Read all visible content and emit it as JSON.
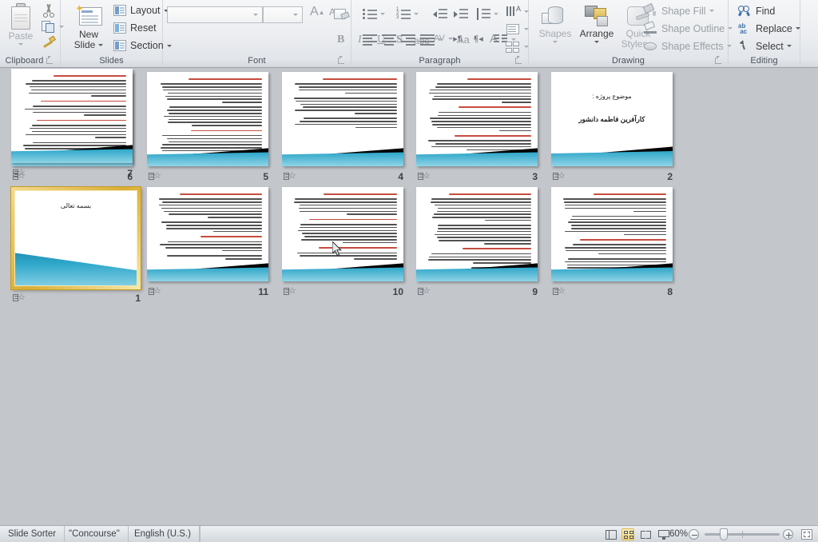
{
  "app": {
    "view_mode": "Slide Sorter",
    "theme_name": "\"Concourse\"",
    "language": "English (U.S.)",
    "zoom_level": "60%"
  },
  "ribbon": {
    "groups": [
      {
        "name": "Clipboard",
        "label": "Clipboard"
      },
      {
        "name": "Slides",
        "label": "Slides"
      },
      {
        "name": "Font",
        "label": "Font"
      },
      {
        "name": "Paragraph",
        "label": "Paragraph"
      },
      {
        "name": "Drawing",
        "label": "Drawing"
      },
      {
        "name": "Editing",
        "label": "Editing"
      }
    ],
    "clipboard": {
      "paste_label": "Paste",
      "cut_icon": "scissors-icon",
      "copy_icon": "copy-icon",
      "format_painter_icon": "format-painter-icon"
    },
    "slides": {
      "new_slide_label_1": "New",
      "new_slide_label_2": "Slide",
      "layout_label": "Layout",
      "reset_label": "Reset",
      "section_label": "Section"
    },
    "font": {
      "font_name_value": "",
      "font_size_value": "",
      "bold_label": "B",
      "italic_label": "I",
      "underline_label": "U",
      "shadow_label": "S",
      "strikethrough_label": "abc",
      "character_spacing_label": "AV",
      "change_case_label": "Aa",
      "font_color_label": "A",
      "grow_font_label": "A",
      "shrink_font_label": "A",
      "clear_formatting_icon": "clear-formatting-icon"
    },
    "paragraph": {
      "bullets_icon": "bullets-icon",
      "numbering_icon": "numbering-icon",
      "decrease_indent_icon": "decrease-indent-icon",
      "increase_indent_icon": "increase-indent-icon",
      "line_spacing_icon": "line-spacing-icon",
      "align_left_icon": "align-left-icon",
      "center_icon": "align-center-icon",
      "align_right_icon": "align-right-icon",
      "justify_icon": "justify-icon",
      "ltr_icon": "left-to-right-icon",
      "rtl_icon": "right-to-left-icon",
      "columns_icon": "columns-icon",
      "text_direction_icon": "text-direction-icon",
      "align_text_icon": "align-text-icon",
      "convert_smartart_icon": "convert-to-smartart-icon"
    },
    "drawing": {
      "shapes_label": "Shapes",
      "arrange_label": "Arrange",
      "quick_styles_label_1": "Quick",
      "quick_styles_label_2": "Styles",
      "shape_fill_label": "Shape Fill",
      "shape_outline_label": "Shape Outline",
      "shape_effects_label": "Shape Effects"
    },
    "editing": {
      "find_label": "Find",
      "replace_label": "Replace",
      "select_label": "Select"
    }
  },
  "slides": [
    {
      "number": "6",
      "kind": "content",
      "title": "",
      "subtitle": "",
      "has_red_heading": false,
      "lines": 26
    },
    {
      "number": "5",
      "kind": "content",
      "title": "",
      "subtitle": "",
      "has_red_heading": true,
      "lines": 22
    },
    {
      "number": "4",
      "kind": "content",
      "title": "",
      "subtitle": "",
      "has_red_heading": true,
      "lines": 14
    },
    {
      "number": "3",
      "kind": "content",
      "title": "",
      "subtitle": "",
      "has_red_heading": true,
      "lines": 18
    },
    {
      "number": "2",
      "kind": "title",
      "title": "موضوع پروژه :",
      "subtitle": "کارآفرین فاطمه دانشور",
      "has_red_heading": false,
      "lines": 0
    },
    {
      "number": "1",
      "kind": "cover",
      "title": "بسمه تعالی",
      "subtitle": "",
      "has_red_heading": false,
      "lines": 0,
      "selected": true
    },
    {
      "number": "11",
      "kind": "content",
      "title": "",
      "subtitle": "",
      "has_red_heading": true,
      "lines": 17
    },
    {
      "number": "10",
      "kind": "content",
      "title": "",
      "subtitle": "",
      "has_red_heading": true,
      "lines": 16
    },
    {
      "number": "9",
      "kind": "content",
      "title": "",
      "subtitle": "",
      "has_red_heading": true,
      "lines": 20
    },
    {
      "number": "8",
      "kind": "content",
      "title": "",
      "subtitle": "",
      "has_red_heading": true,
      "lines": 22
    },
    {
      "number": "7",
      "kind": "content",
      "title": "",
      "subtitle": "",
      "has_red_heading": true,
      "lines": 21
    }
  ],
  "status_bar": {
    "view_normal_icon": "normal-view-icon",
    "view_sorter_icon": "slide-sorter-view-icon",
    "view_reading_icon": "reading-view-icon",
    "view_show_icon": "slide-show-icon",
    "zoom_out_icon": "zoom-out-icon",
    "zoom_in_icon": "zoom-in-icon",
    "fit_window_icon": "fit-to-window-icon"
  },
  "colors": {
    "selection": "#d9ae35",
    "canvas": "#c3c6cb",
    "accent_teal": "#2ea6c9",
    "heading_red": "#c0392b"
  }
}
